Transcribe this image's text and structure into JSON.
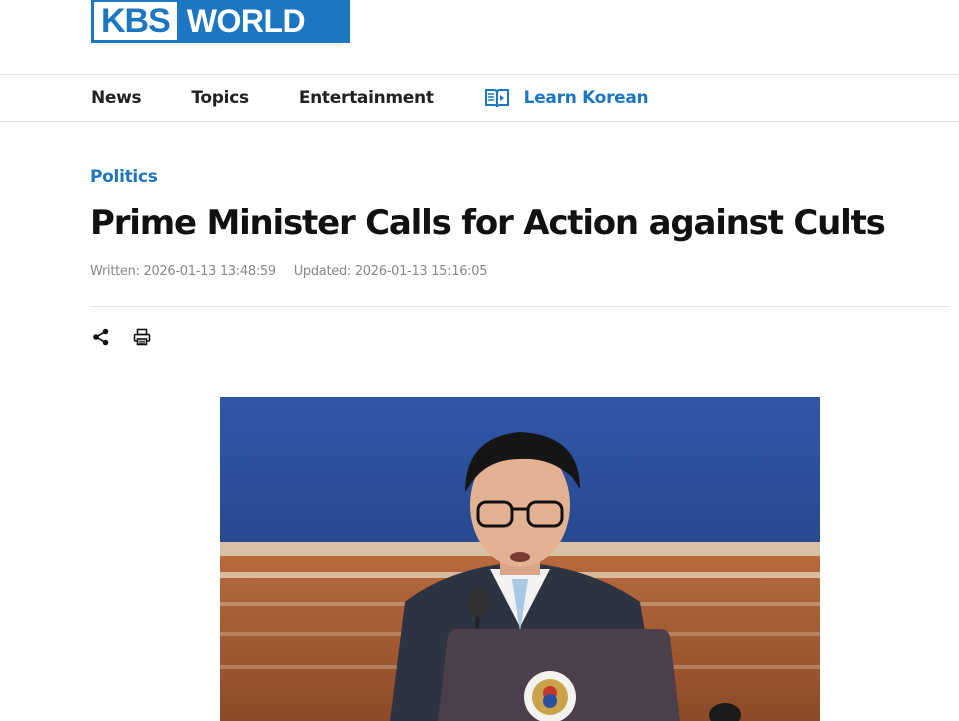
{
  "header": {
    "logo": {
      "part1": "KBS",
      "part2": "WORLD"
    }
  },
  "nav": {
    "items": [
      "News",
      "Topics",
      "Entertainment"
    ],
    "learn_korean": {
      "label": "Learn Korean",
      "icon": "book-icon"
    }
  },
  "article": {
    "category": "Politics",
    "title": "Prime Minister Calls for Action against Cults",
    "written": "Written: 2026-01-13 13:48:59",
    "updated": "Updated: 2026-01-13 15:16:05",
    "tools": [
      "share-icon",
      "print-icon"
    ],
    "image": {
      "subject": "photo-of-speaker-at-podium"
    }
  },
  "colors": {
    "brand": "#1c76c2",
    "text": "#111111",
    "meta": "#888888",
    "divider": "#e2e2e2"
  }
}
